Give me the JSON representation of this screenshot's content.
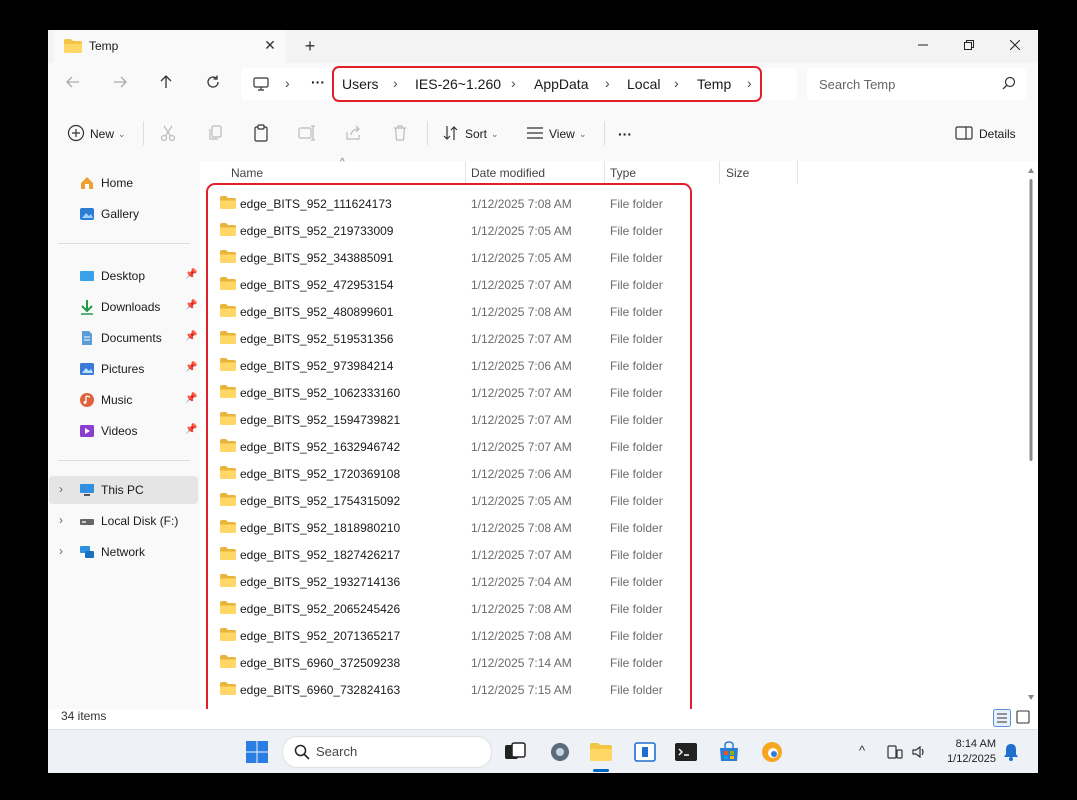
{
  "window": {
    "tab_title": "Temp",
    "tab_close": "✕",
    "new_tab": "+"
  },
  "address_bar": {
    "breadcrumbs": [
      "Users",
      "IES-26~1.260",
      "AppData",
      "Local",
      "Temp"
    ],
    "overflow": "···"
  },
  "search": {
    "placeholder": "Search Temp"
  },
  "toolbar": {
    "new_label": "New",
    "sort_label": "Sort",
    "view_label": "View",
    "more_label": "···",
    "details_label": "Details"
  },
  "sidebar": {
    "quick": [
      {
        "label": "Home",
        "icon": "home-icon"
      },
      {
        "label": "Gallery",
        "icon": "gallery-icon"
      }
    ],
    "pinned": [
      {
        "label": "Desktop",
        "icon": "desktop-icon"
      },
      {
        "label": "Downloads",
        "icon": "downloads-icon"
      },
      {
        "label": "Documents",
        "icon": "documents-icon"
      },
      {
        "label": "Pictures",
        "icon": "pictures-icon"
      },
      {
        "label": "Music",
        "icon": "music-icon"
      },
      {
        "label": "Videos",
        "icon": "videos-icon"
      }
    ],
    "drives": [
      {
        "label": "This PC",
        "icon": "this-pc-icon"
      },
      {
        "label": "Local Disk (F:)",
        "icon": "local-disk-icon"
      },
      {
        "label": "Network",
        "icon": "network-icon"
      }
    ]
  },
  "columns": {
    "name": "Name",
    "date": "Date modified",
    "type": "Type",
    "size": "Size"
  },
  "files": [
    {
      "name": "edge_BITS_952_111624173",
      "date": "1/12/2025 7:08 AM",
      "type": "File folder"
    },
    {
      "name": "edge_BITS_952_219733009",
      "date": "1/12/2025 7:05 AM",
      "type": "File folder"
    },
    {
      "name": "edge_BITS_952_343885091",
      "date": "1/12/2025 7:05 AM",
      "type": "File folder"
    },
    {
      "name": "edge_BITS_952_472953154",
      "date": "1/12/2025 7:07 AM",
      "type": "File folder"
    },
    {
      "name": "edge_BITS_952_480899601",
      "date": "1/12/2025 7:08 AM",
      "type": "File folder"
    },
    {
      "name": "edge_BITS_952_519531356",
      "date": "1/12/2025 7:07 AM",
      "type": "File folder"
    },
    {
      "name": "edge_BITS_952_973984214",
      "date": "1/12/2025 7:06 AM",
      "type": "File folder"
    },
    {
      "name": "edge_BITS_952_1062333160",
      "date": "1/12/2025 7:07 AM",
      "type": "File folder"
    },
    {
      "name": "edge_BITS_952_1594739821",
      "date": "1/12/2025 7:07 AM",
      "type": "File folder"
    },
    {
      "name": "edge_BITS_952_1632946742",
      "date": "1/12/2025 7:07 AM",
      "type": "File folder"
    },
    {
      "name": "edge_BITS_952_1720369108",
      "date": "1/12/2025 7:06 AM",
      "type": "File folder"
    },
    {
      "name": "edge_BITS_952_1754315092",
      "date": "1/12/2025 7:05 AM",
      "type": "File folder"
    },
    {
      "name": "edge_BITS_952_1818980210",
      "date": "1/12/2025 7:08 AM",
      "type": "File folder"
    },
    {
      "name": "edge_BITS_952_1827426217",
      "date": "1/12/2025 7:07 AM",
      "type": "File folder"
    },
    {
      "name": "edge_BITS_952_1932714136",
      "date": "1/12/2025 7:04 AM",
      "type": "File folder"
    },
    {
      "name": "edge_BITS_952_2065245426",
      "date": "1/12/2025 7:08 AM",
      "type": "File folder"
    },
    {
      "name": "edge_BITS_952_2071365217",
      "date": "1/12/2025 7:08 AM",
      "type": "File folder"
    },
    {
      "name": "edge_BITS_6960_372509238",
      "date": "1/12/2025 7:14 AM",
      "type": "File folder"
    },
    {
      "name": "edge_BITS_6960_732824163",
      "date": "1/12/2025 7:15 AM",
      "type": "File folder"
    }
  ],
  "status": {
    "item_count": "34 items"
  },
  "taskbar": {
    "search_label": "Search",
    "time": "8:14 AM",
    "date": "1/12/2025"
  },
  "colors": {
    "highlight": "#e0212b",
    "folder": "#f4c542",
    "accent": "#0067c0"
  }
}
